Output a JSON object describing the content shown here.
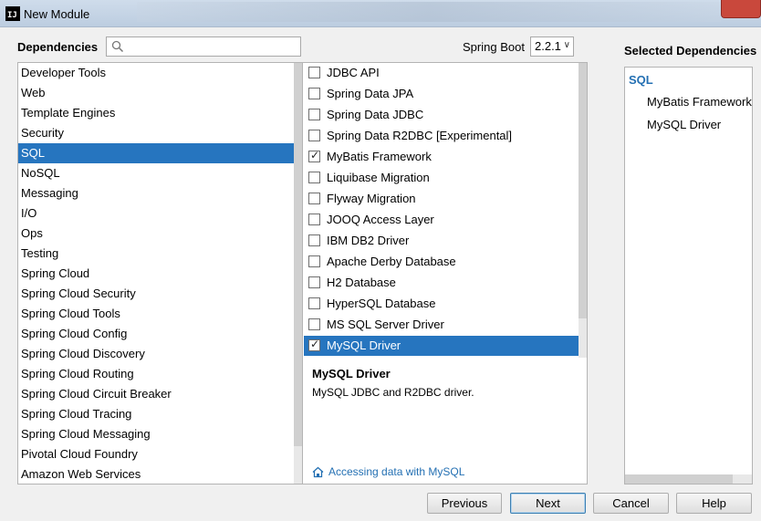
{
  "window": {
    "title": "New Module",
    "icon_text": "IJ"
  },
  "header": {
    "dependencies_label": "Dependencies",
    "search_placeholder": "",
    "spring_boot_label": "Spring Boot",
    "spring_boot_version": "2.2.1"
  },
  "categories": [
    {
      "label": "Developer Tools",
      "selected": false
    },
    {
      "label": "Web",
      "selected": false
    },
    {
      "label": "Template Engines",
      "selected": false
    },
    {
      "label": "Security",
      "selected": false
    },
    {
      "label": "SQL",
      "selected": true
    },
    {
      "label": "NoSQL",
      "selected": false
    },
    {
      "label": "Messaging",
      "selected": false
    },
    {
      "label": "I/O",
      "selected": false
    },
    {
      "label": "Ops",
      "selected": false
    },
    {
      "label": "Testing",
      "selected": false
    },
    {
      "label": "Spring Cloud",
      "selected": false
    },
    {
      "label": "Spring Cloud Security",
      "selected": false
    },
    {
      "label": "Spring Cloud Tools",
      "selected": false
    },
    {
      "label": "Spring Cloud Config",
      "selected": false
    },
    {
      "label": "Spring Cloud Discovery",
      "selected": false
    },
    {
      "label": "Spring Cloud Routing",
      "selected": false
    },
    {
      "label": "Spring Cloud Circuit Breaker",
      "selected": false
    },
    {
      "label": "Spring Cloud Tracing",
      "selected": false
    },
    {
      "label": "Spring Cloud Messaging",
      "selected": false
    },
    {
      "label": "Pivotal Cloud Foundry",
      "selected": false
    },
    {
      "label": "Amazon Web Services",
      "selected": false
    }
  ],
  "dependencies": [
    {
      "label": "JDBC API",
      "checked": false,
      "selected": false
    },
    {
      "label": "Spring Data JPA",
      "checked": false,
      "selected": false
    },
    {
      "label": "Spring Data JDBC",
      "checked": false,
      "selected": false
    },
    {
      "label": "Spring Data R2DBC [Experimental]",
      "checked": false,
      "selected": false
    },
    {
      "label": "MyBatis Framework",
      "checked": true,
      "selected": false
    },
    {
      "label": "Liquibase Migration",
      "checked": false,
      "selected": false
    },
    {
      "label": "Flyway Migration",
      "checked": false,
      "selected": false
    },
    {
      "label": "JOOQ Access Layer",
      "checked": false,
      "selected": false
    },
    {
      "label": "IBM DB2 Driver",
      "checked": false,
      "selected": false
    },
    {
      "label": "Apache Derby Database",
      "checked": false,
      "selected": false
    },
    {
      "label": "H2 Database",
      "checked": false,
      "selected": false
    },
    {
      "label": "HyperSQL Database",
      "checked": false,
      "selected": false
    },
    {
      "label": "MS SQL Server Driver",
      "checked": false,
      "selected": false
    },
    {
      "label": "MySQL Driver",
      "checked": true,
      "selected": true
    }
  ],
  "description": {
    "title": "MySQL Driver",
    "text": "MySQL JDBC and R2DBC driver.",
    "guide_link": "Accessing data with MySQL"
  },
  "selected_panel": {
    "title": "Selected Dependencies",
    "group": "SQL",
    "items": [
      "MyBatis Framework",
      "MySQL Driver"
    ]
  },
  "buttons": {
    "previous": "Previous",
    "next": "Next",
    "cancel": "Cancel",
    "help": "Help"
  },
  "colors": {
    "selection": "#2675bf",
    "link": "#2470b3"
  }
}
